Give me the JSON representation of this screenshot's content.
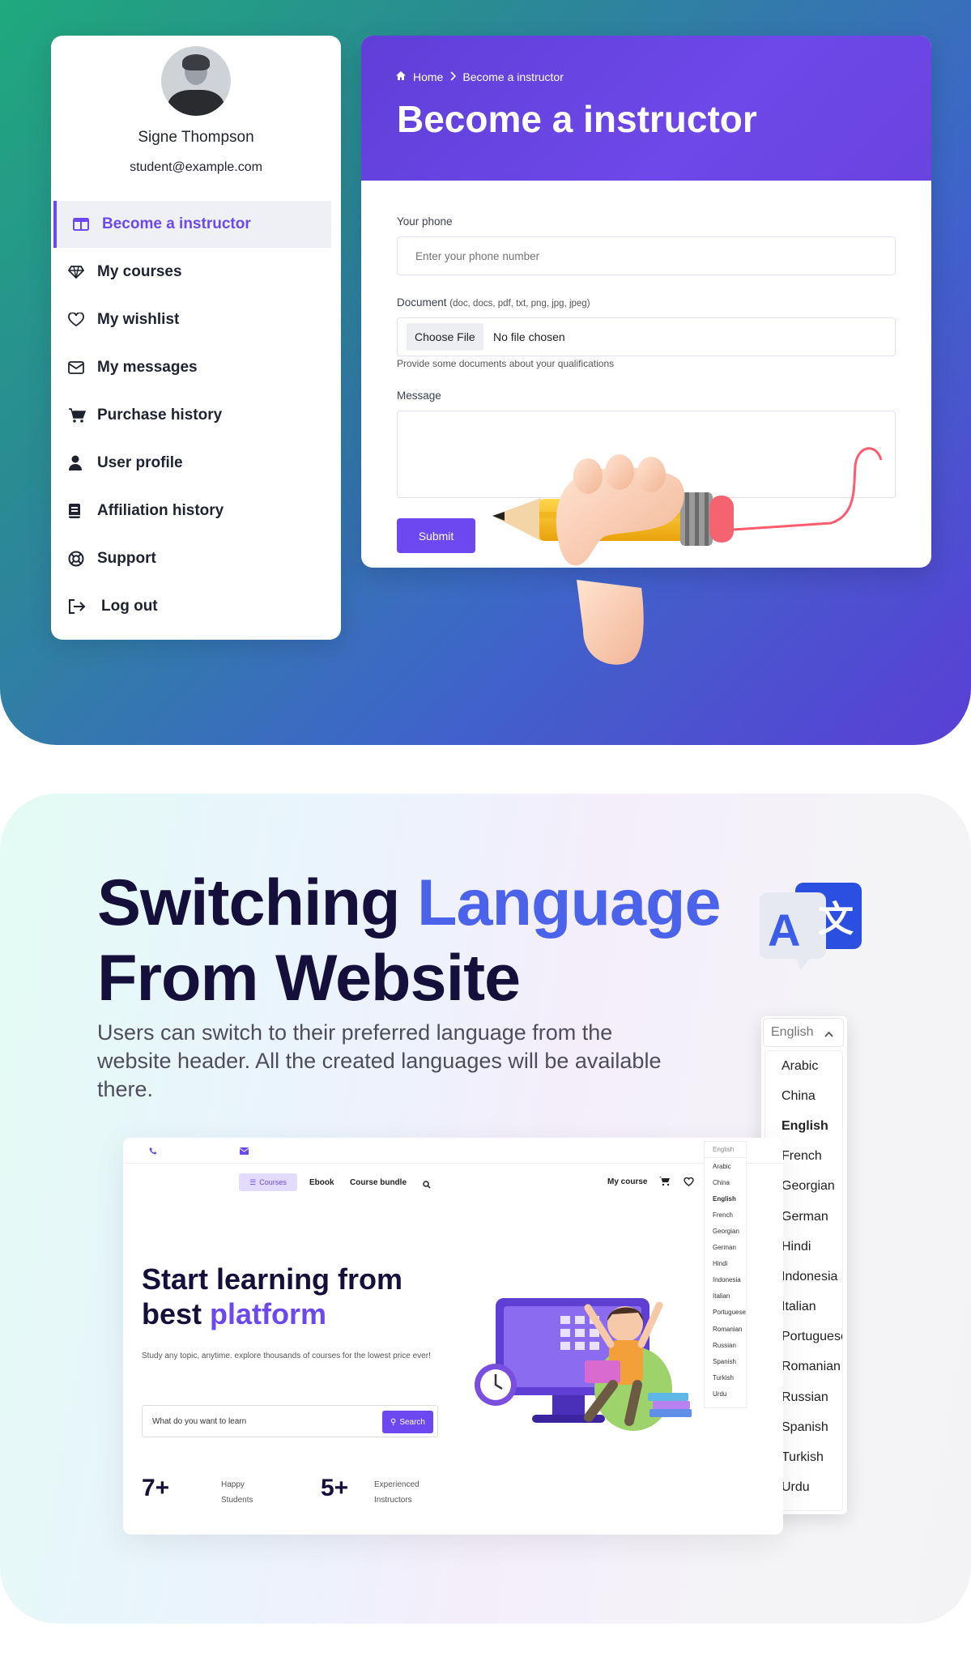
{
  "sidebar": {
    "name": "Signe Thompson",
    "email": "student@example.com",
    "items": [
      {
        "label": "Become a instructor",
        "icon": "columns-icon",
        "active": true
      },
      {
        "label": "My courses",
        "icon": "diamond-icon"
      },
      {
        "label": "My wishlist",
        "icon": "heart-icon"
      },
      {
        "label": "My messages",
        "icon": "envelope-icon"
      },
      {
        "label": "Purchase history",
        "icon": "cart-icon"
      },
      {
        "label": "User profile",
        "icon": "user-icon"
      },
      {
        "label": "Affiliation history",
        "icon": "book-icon"
      },
      {
        "label": "Support",
        "icon": "lifebuoy-icon"
      },
      {
        "label": "Log out",
        "icon": "logout-icon"
      }
    ]
  },
  "form": {
    "breadcrumb": {
      "home": "Home",
      "current": "Become a instructor"
    },
    "title": "Become a instructor",
    "phone_label": "Your phone",
    "phone_placeholder": "Enter your phone number",
    "document_label": "Document",
    "document_types": "(doc, docs, pdf, txt, png, jpg, jpeg)",
    "choose_file": "Choose File",
    "no_file": "No file chosen",
    "document_hint": "Provide some documents about your qualifications",
    "message_label": "Message",
    "submit": "Submit"
  },
  "feature": {
    "title_part1": "Switching",
    "title_accent": "Language",
    "title_line2": "From Website",
    "description": "Users can switch to their preferred language from the website header. All the created languages will be available there."
  },
  "language_dropdown": {
    "selected": "English",
    "options": [
      "Arabic",
      "China",
      "English",
      "French",
      "Georgian",
      "German",
      "Hindi",
      "Indonesia",
      "Italian",
      "Portuguese",
      "Romanian",
      "Russian",
      "Spanish",
      "Turkish",
      "Urdu"
    ]
  },
  "mockup": {
    "nav": {
      "courses": "Courses",
      "ebook": "Ebook",
      "course_bundle": "Course bundle",
      "my_course": "My course"
    },
    "dropdown_selected": "English",
    "dropdown_options": [
      "Arabic",
      "China",
      "English",
      "French",
      "Georgian",
      "German",
      "Hindi",
      "Indonesia",
      "Italian",
      "Portuguese",
      "Romanian",
      "Russian",
      "Spanish",
      "Turkish",
      "Urdu"
    ],
    "hero_line1": "Start learning from",
    "hero_line2a": "best",
    "hero_accent": "platform",
    "subtitle": "Study any topic, anytime. explore thousands of courses for the lowest price ever!",
    "search_placeholder": "What do you want to learn",
    "search_button": "Search",
    "stat1_value": "7+",
    "stat1_label": "Happy Students",
    "stat2_value": "5+",
    "stat2_label": "Experienced Instructors"
  },
  "colors": {
    "accent": "#6b48f0",
    "heading": "#15103b",
    "blue_accent": "#4b62ea"
  }
}
